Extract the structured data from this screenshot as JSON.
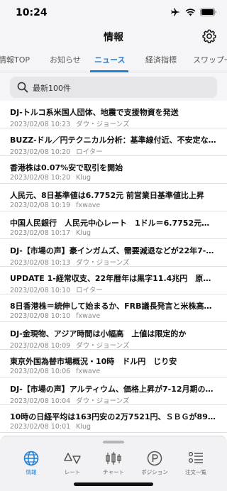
{
  "status": {
    "time": "10:24"
  },
  "nav": {
    "title": "情報"
  },
  "tabs": [
    {
      "label": "情報TOP"
    },
    {
      "label": "お知らせ"
    },
    {
      "label": "ニュース"
    },
    {
      "label": "経済指標"
    },
    {
      "label": "スワップ一"
    }
  ],
  "search": {
    "label": "最新100件"
  },
  "news": [
    {
      "title": "DJ-トルコ系米国人団体、地震で支援物資を発送",
      "time": "2023/02/08 10:23",
      "source": "ダウ・ジョーンズ"
    },
    {
      "title": "BUZZ-ドル／円テクニカル分析：基準線付近、不安定な…",
      "time": "2023/02/08 10:20",
      "source": "ロイター"
    },
    {
      "title": "香港株は0.07%安で取引を開始",
      "time": "2023/02/08 10:20",
      "source": "Klug"
    },
    {
      "title": "人民元、8日基準値は6.7752元 前営業日基準値比上昇",
      "time": "2023/02/08 10:19",
      "source": "fxwave"
    },
    {
      "title": "中国人民銀行　人民元中心レート　1ドル＝6.7752元（…",
      "time": "2023/02/08 10:17",
      "source": "Klug"
    },
    {
      "title": "DJ-【市場の声】豪インガムズ、需要減退などが22年7-1…",
      "time": "2023/02/08 10:13",
      "source": "ダウ・ジョーンズ"
    },
    {
      "title": "UPDATE 1-経常収支、22年暦年は黒字11.4兆円　原油高…",
      "time": "2023/02/08 10:10",
      "source": "ロイター"
    },
    {
      "title": "8日香港株＝続伸して始まるか、FRB議長発言と米株高が…",
      "time": "2023/02/08 10:10",
      "source": "fxwave"
    },
    {
      "title": "DJ-金現物、アジア時間は小幅高　上値は限定的か",
      "time": "2023/02/08 10:09",
      "source": "ダウ・ジョーンズ"
    },
    {
      "title": "東京外国為替市場概況・10時　ドル円　じり安",
      "time": "2023/02/08 10:06",
      "source": "fxwave"
    },
    {
      "title": "DJ-【市場の声】アルティウム、価格上昇が7-12月期の…",
      "time": "2023/02/08 10:04",
      "source": "ダウ・ジョーンズ"
    },
    {
      "title": "10時の日経平均は163円安の2万7521円、ＳＢＧが89.58…",
      "time": "2023/02/08 10:01",
      "source": "Klug"
    }
  ],
  "bottom_tabs": [
    {
      "label": "情報",
      "icon": "globe-icon"
    },
    {
      "label": "レート",
      "icon": "rate-triangles-icon"
    },
    {
      "label": "チャート",
      "icon": "candlestick-icon"
    },
    {
      "label": "ポジション",
      "icon": "position-p-icon"
    },
    {
      "label": "注文一覧",
      "icon": "order-list-icon"
    }
  ],
  "colors": {
    "accent": "#1e7ed6",
    "meta": "#8a8a8e"
  }
}
